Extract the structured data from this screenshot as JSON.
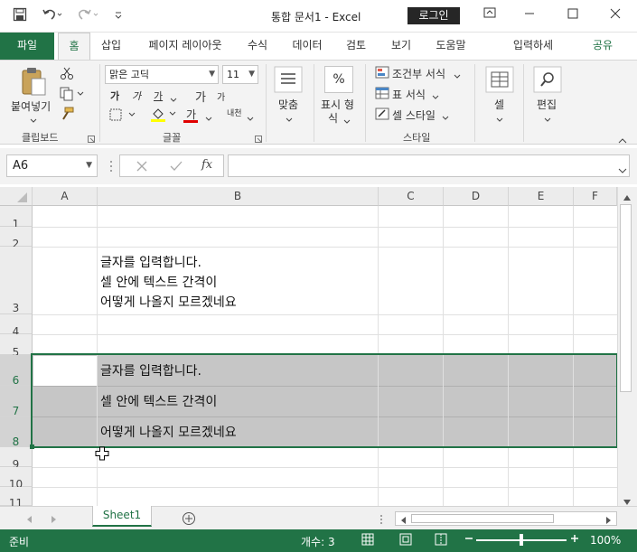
{
  "titlebar": {
    "document_title": "통합 문서1  -  Excel",
    "login_label": "로그인"
  },
  "tabs": [
    {
      "label": "파일"
    },
    {
      "label": "홈"
    },
    {
      "label": "삽입"
    },
    {
      "label": "페이지 레이아웃"
    },
    {
      "label": "수식"
    },
    {
      "label": "데이터"
    },
    {
      "label": "검토"
    },
    {
      "label": "보기"
    },
    {
      "label": "도움말"
    },
    {
      "label": "입력하세"
    },
    {
      "label": "공유"
    }
  ],
  "ribbon": {
    "clipboard": {
      "paste_label": "붙여넣기",
      "group_label": "클립보드"
    },
    "font": {
      "font_name": "맑은 고딕",
      "font_size": "11",
      "group_label": "글꼴",
      "bold": "가",
      "italic": "가",
      "underline": "가",
      "grow": "가",
      "shrink": "가",
      "font_color": "가",
      "phonetic": "내천"
    },
    "alignment": {
      "label": "맞춤"
    },
    "number": {
      "label_line1": "표시 형",
      "label_line2": "식",
      "percent": "%"
    },
    "styles": {
      "conditional": "조건부 서식",
      "table": "표 서식",
      "cell_style": "셀 스타일",
      "group_label": "스타일"
    },
    "cells": {
      "label": "셀"
    },
    "editing": {
      "label": "편집"
    }
  },
  "formula_bar": {
    "name_box": "A6",
    "fx": "fx",
    "formula": ""
  },
  "columns": [
    "A",
    "B",
    "C",
    "D",
    "E",
    "F"
  ],
  "rows": [
    "1",
    "2",
    "3",
    "4",
    "5",
    "6",
    "7",
    "8",
    "9",
    "10",
    "11"
  ],
  "cells": {
    "b3_line1": "글자를 입력합니다.",
    "b3_line2": "셀 안에 텍스트 간격이",
    "b3_line3": "어떻게 나올지 모르겠네요",
    "b6": "글자를 입력합니다.",
    "b7": "셀 안에 텍스트 간격이",
    "b8": "어떻게 나올지 모르겠네요"
  },
  "sheets": {
    "active": "Sheet1"
  },
  "status": {
    "ready": "준비",
    "count": "개수: 3",
    "zoom": "100%"
  },
  "colors": {
    "accent": "#217346",
    "selection": "#c6c6c6"
  }
}
